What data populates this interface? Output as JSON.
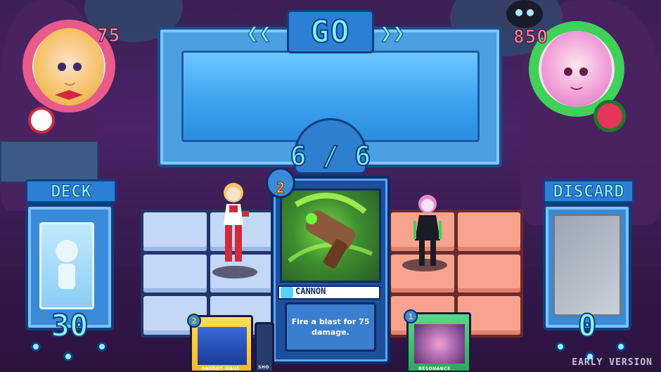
{
  "banner": {
    "title": "GO",
    "energy": "6 / 6"
  },
  "player": {
    "hp": "75"
  },
  "enemy": {
    "hp": "850"
  },
  "deck": {
    "label": "DECK",
    "count": "30"
  },
  "discard": {
    "label": "DISCARD",
    "count": "0"
  },
  "selected_card": {
    "cost": "2",
    "name": "CANNON",
    "description": "Fire a blast for 75 damage."
  },
  "hand": [
    {
      "cost": "2",
      "label": "ENERGY WAVE"
    },
    {
      "cost": "",
      "label": "SHO"
    },
    {
      "cost": "1",
      "label": "RESONANCE"
    }
  ],
  "watermark": "EARLY VERSION",
  "colors": {
    "ui_blue": "#2c7fd4",
    "ui_cyan": "#8ff3ff",
    "player_tile": "#c3d7f6",
    "enemy_tile": "#f7a38f",
    "player_ring": "#e85a8a",
    "enemy_ring": "#3fd15a"
  }
}
